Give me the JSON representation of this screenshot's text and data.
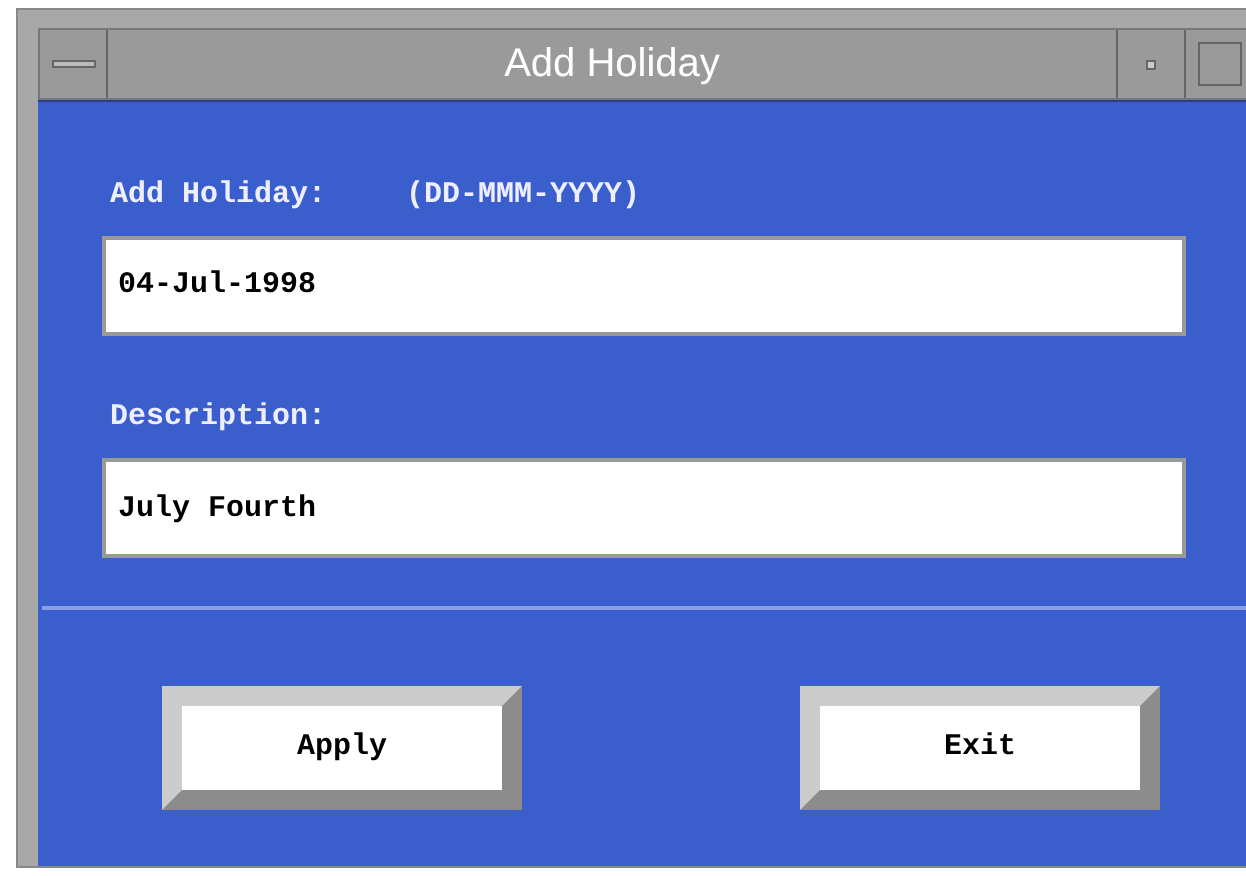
{
  "window": {
    "title": "Add Holiday"
  },
  "date_label": "Add Holiday:",
  "date_format": "(DD-MMM-YYYY)",
  "date_field": {
    "value": "04-Jul-1998"
  },
  "description_label": "Description:",
  "description_field": {
    "value": "July Fourth"
  },
  "buttons": [
    "Apply",
    "Exit"
  ]
}
